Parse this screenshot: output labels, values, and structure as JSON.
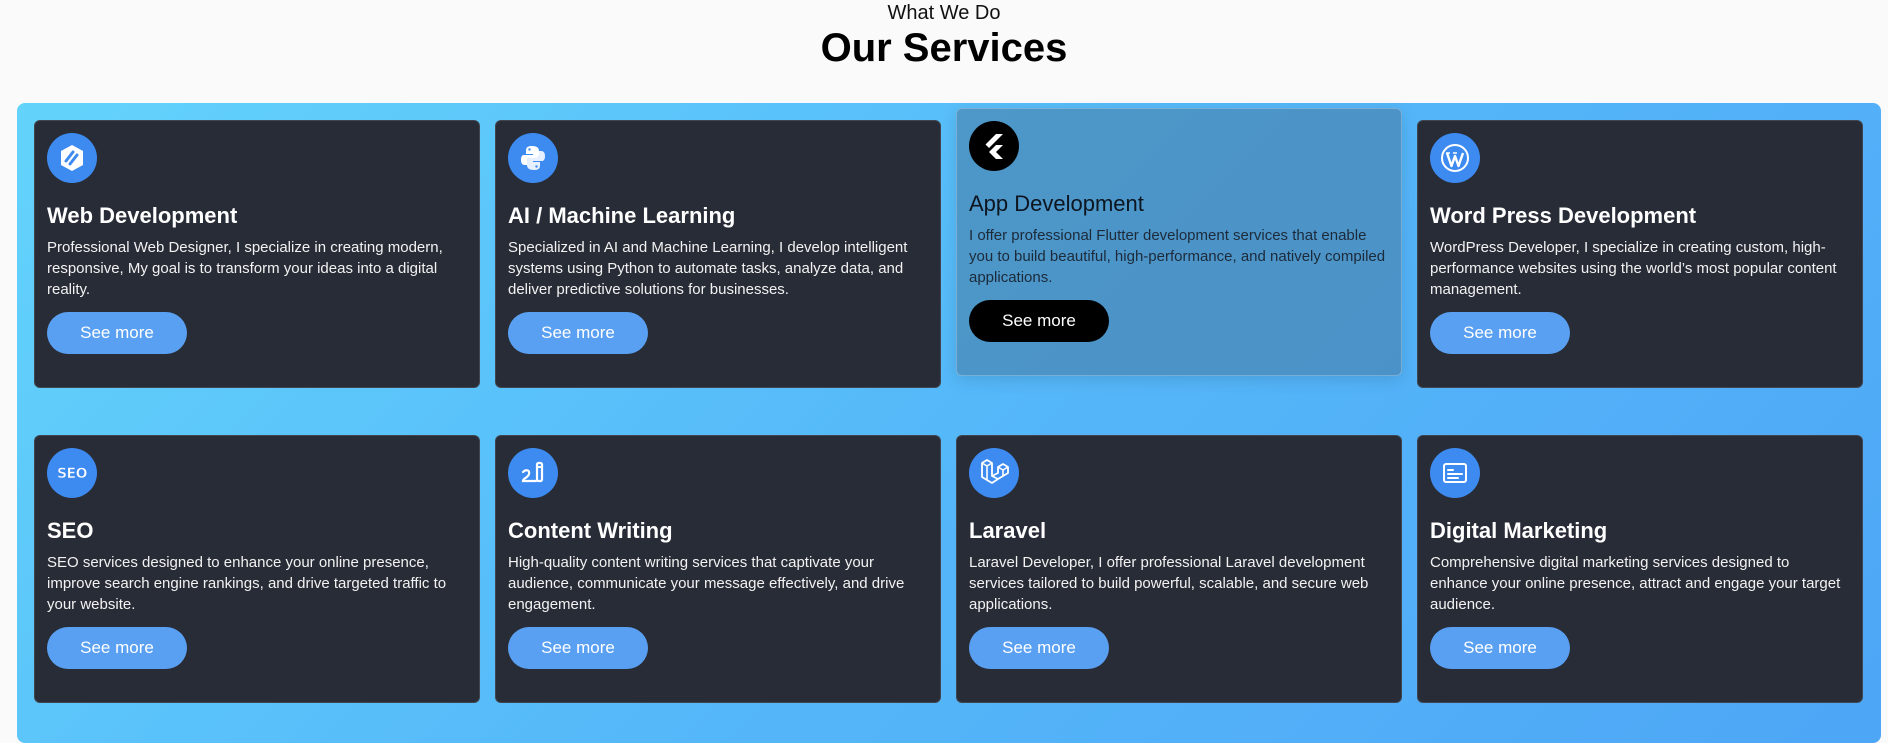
{
  "header": {
    "subtitle": "What We Do",
    "title": "Our Services"
  },
  "services": [
    {
      "title": "Web Development",
      "description": "Professional Web Designer, I specialize in creating modern, responsive, My goal is to transform your ideas into a digital reality.",
      "button": "See more",
      "icon": "web-development-icon"
    },
    {
      "title": "AI / Machine Learning",
      "description": "Specialized in AI and Machine Learning, I develop intelligent systems using Python to automate tasks, analyze data, and deliver predictive solutions for businesses.",
      "button": "See more",
      "icon": "python-icon"
    },
    {
      "title": "App Development",
      "description": "I offer professional Flutter development services that enable you to build beautiful, high-performance, and natively compiled applications.",
      "button": "See more",
      "icon": "flutter-icon"
    },
    {
      "title": "Word Press Development",
      "description": "WordPress Developer, I specialize in creating custom, high-performance websites using the world’s most popular content management.",
      "button": "See more",
      "icon": "wordpress-icon"
    },
    {
      "title": "SEO",
      "description": "SEO services designed to enhance your online presence, improve search engine rankings, and drive targeted traffic to your website.",
      "button": "See more",
      "icon": "seo-icon"
    },
    {
      "title": "Content Writing",
      "description": "High-quality content writing services that captivate your audience, communicate your message effectively, and drive engagement.",
      "button": "See more",
      "icon": "pen-icon"
    },
    {
      "title": "Laravel",
      "description": "Laravel Developer, I offer professional Laravel development services tailored to build powerful, scalable, and secure web applications.",
      "button": "See more",
      "icon": "laravel-icon"
    },
    {
      "title": "Digital Marketing",
      "description": "Comprehensive digital marketing services designed to enhance your online presence, attract and engage your target audience.",
      "button": "See more",
      "icon": "marketing-card-icon"
    }
  ],
  "colors": {
    "card_bg": "#282c36",
    "accent": "#5aa0f2",
    "icon_bg": "#3d8bf0",
    "panel_gradient_start": "#63d3fb",
    "panel_gradient_end": "#4ea6f6"
  }
}
